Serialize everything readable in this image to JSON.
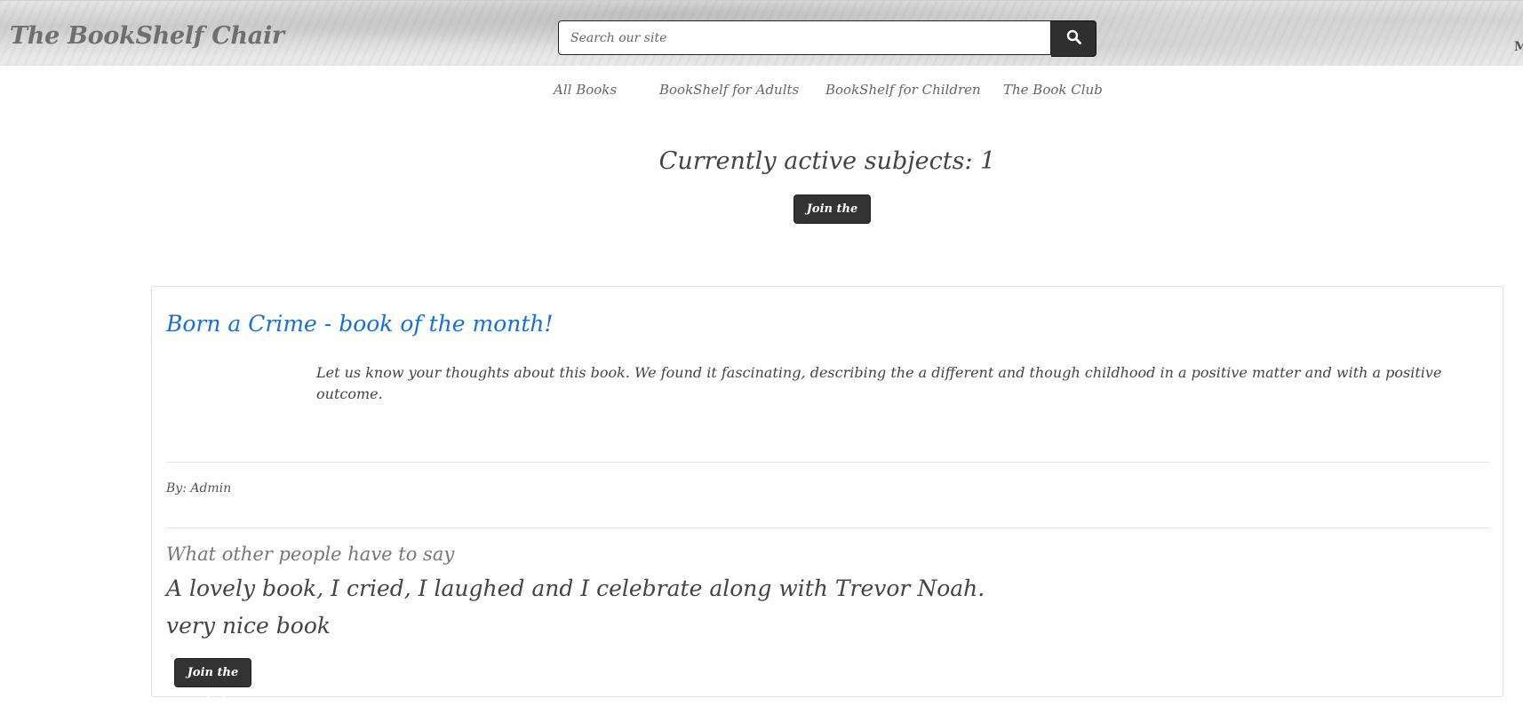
{
  "header": {
    "brand": "The BookShelf Chair",
    "search": {
      "placeholder": "Search our site",
      "value": ""
    },
    "search_icon": "search-icon",
    "edge_letter": "M"
  },
  "nav": {
    "items": [
      {
        "label": "All Books"
      },
      {
        "label": "BookShelf for Adults"
      },
      {
        "label": "BookShelf for Children"
      },
      {
        "label": "The Book Club"
      }
    ]
  },
  "main": {
    "subjects_label": "Currently active subjects: 1",
    "join_label": "Join the chat"
  },
  "post": {
    "title": "Born a Crime - book of the month!",
    "body": "Let us know your thoughts about this book. We found it fascinating, describing the a different and though childhood in a positive matter and with a positive outcome.",
    "byline": "By: Admin",
    "comments_heading": "What other people have to say",
    "comments": [
      {
        "text": "A lovely book, I cried, I laughed and I celebrate along with Trevor Noah."
      },
      {
        "text": "very nice book"
      }
    ],
    "join_label": "Join the chat"
  },
  "colors": {
    "link": "#1a6fd1",
    "button": "#333333",
    "text": "#444444"
  }
}
